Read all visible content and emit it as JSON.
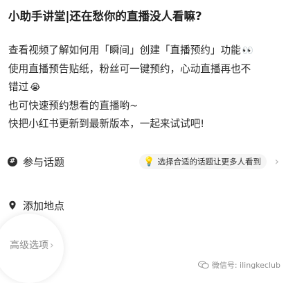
{
  "post": {
    "title": "小助手讲堂|还在愁你的直播没人看嘛?",
    "body_lines": [
      "查看视频了解如何用「瞬间」创建「直播预约」功能",
      "使用直播预告贴纸，粉丝可一键预约，心动直播再也不",
      "错过",
      "也可快速预约想看的直播哟~",
      "快把小红书更新到最新版本，一起来试试吧!"
    ],
    "emoji_eyes": "👀",
    "emoji_face": "😭"
  },
  "topic": {
    "icon": "hash-icon",
    "label": "参与话题",
    "hint_icon": "lightbulb-icon",
    "hint": "选择合适的话题让更多人看到"
  },
  "location": {
    "icon": "location-pin-icon",
    "label": "添加地点"
  },
  "advanced": {
    "label": "高级选项"
  },
  "watermark": {
    "icon": "wechat-icon",
    "text": "微信号: ilingkeclub"
  }
}
